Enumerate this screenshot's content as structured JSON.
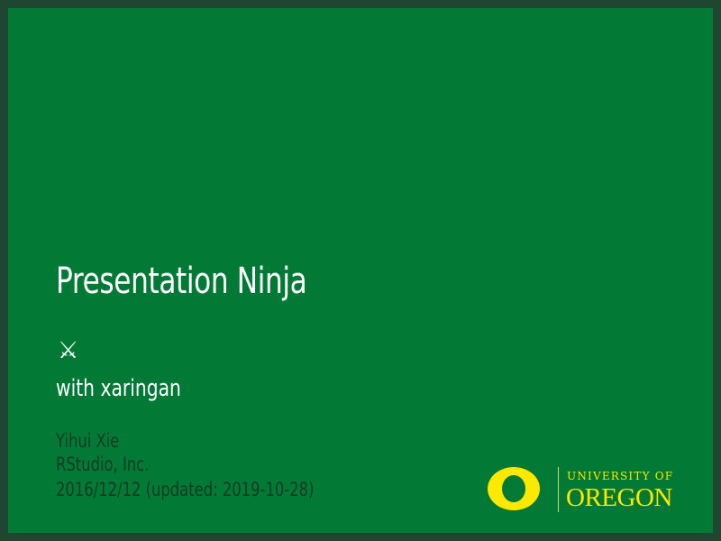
{
  "slide": {
    "title": "Presentation Ninja",
    "swords_glyph": "⚔",
    "subtitle": "with xaringan",
    "author": "Yihui Xie",
    "institute": "RStudio, Inc.",
    "date": "2016/12/12 (updated: 2019-10-28)"
  },
  "logo": {
    "line1": "UNIVERSITY OF",
    "line2": "OREGON"
  },
  "colors": {
    "background": "#027a36",
    "frame": "#1f4630",
    "title_text": "#ffffff",
    "meta_text": "#183a22",
    "logo_yellow": "#fde800"
  }
}
